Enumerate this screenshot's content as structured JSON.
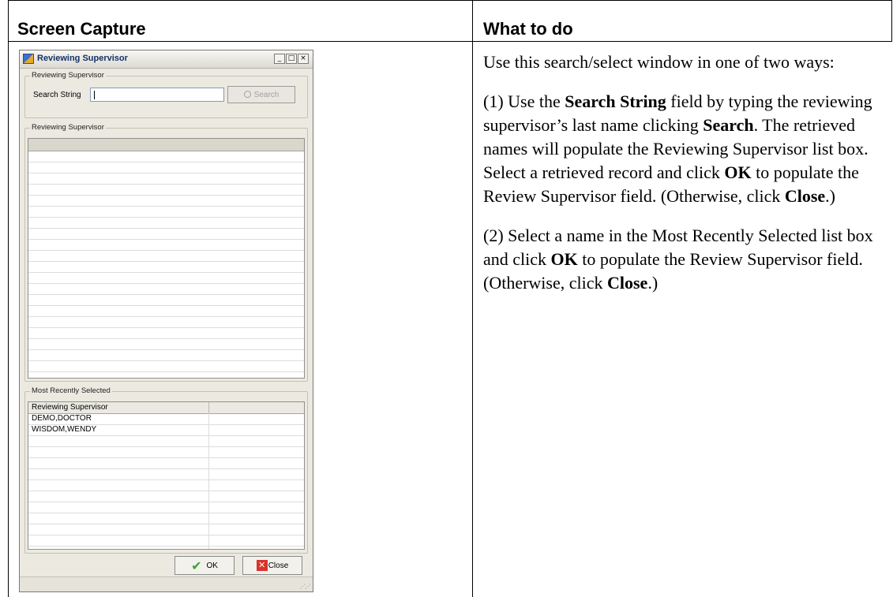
{
  "table": {
    "col1_header": "Screen Capture",
    "col2_header": "What to do"
  },
  "dialog": {
    "title": "Reviewing Supervisor",
    "window_buttons": [
      "_",
      "□",
      "×"
    ],
    "search_group_label": "Reviewing Supervisor",
    "search_label": "Search String",
    "search_value": "",
    "search_button": "Search",
    "results_group_label": "Reviewing Supervisor",
    "recent_group_label": "Most Recently Selected",
    "recent_column": "Reviewing Supervisor",
    "recent_items": [
      "DEMO,DOCTOR",
      "WISDOM,WENDY"
    ],
    "ok_label": "OK",
    "close_label": "Close",
    "icons": {
      "app": "app-icon",
      "search": "magnifier-icon",
      "ok": "check-icon",
      "close": "x-icon",
      "grip": "resize-grip-icon"
    }
  },
  "instructions": {
    "p1": "Use this search/select window in one of two ways:",
    "p2": {
      "a": "(1) Use the ",
      "b": "Search String",
      "c": " field by typing the reviewing supervisor’s last name clicking ",
      "d": "Search",
      "e": ". The retrieved names will populate the Reviewing Supervisor list box. Select a retrieved record and click ",
      "f": "OK",
      "g": " to populate the Review Supervisor field. (Otherwise, click ",
      "h": "Close",
      "i": ".)"
    },
    "p3": {
      "a": "(2) Select a name in the Most Recently Selected list box and click ",
      "b": "OK",
      "c": " to populate the Review Supervisor field. (Otherwise, click ",
      "d": "Close",
      "e": ".)"
    }
  },
  "colors": {
    "dialog_bg": "#ece9e1",
    "title_text": "#14316a",
    "ok_check": "#3aa335",
    "close_red": "#d8332a"
  }
}
